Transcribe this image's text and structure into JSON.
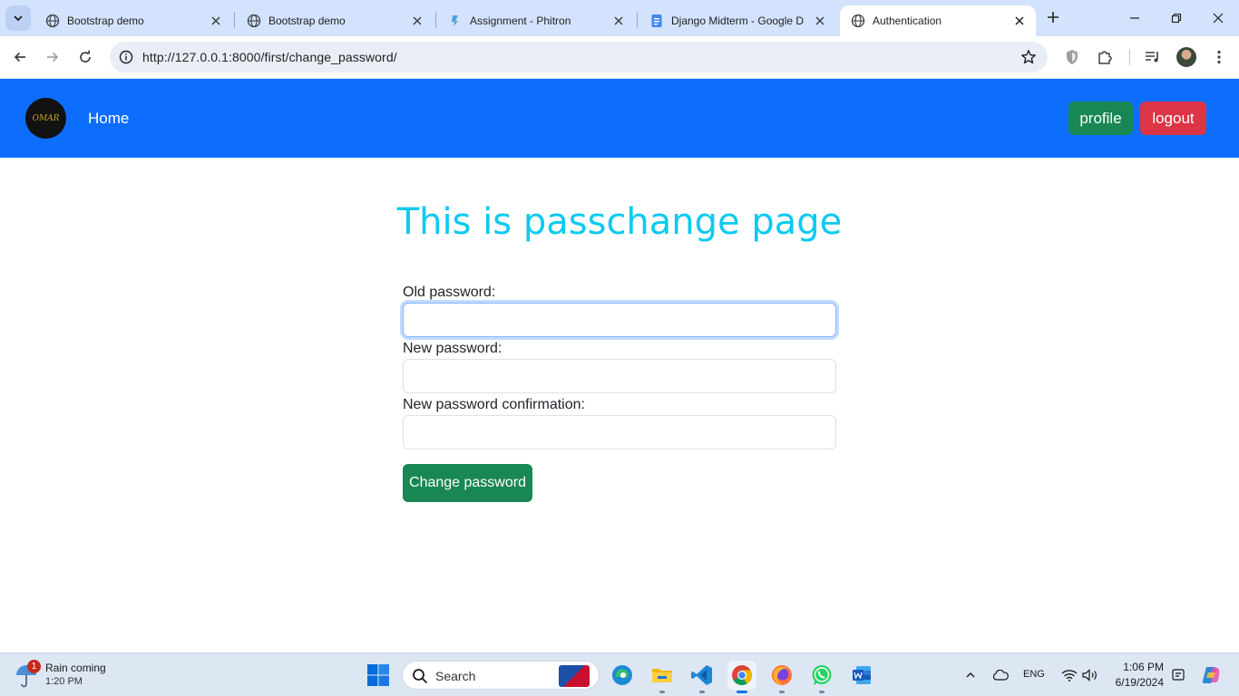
{
  "browser": {
    "tabs": [
      {
        "title": "Bootstrap demo",
        "icon": "globe-icon",
        "active": false
      },
      {
        "title": "Bootstrap demo",
        "icon": "globe-icon",
        "active": false
      },
      {
        "title": "Assignment - Phitron",
        "icon": "phitron-icon",
        "active": false
      },
      {
        "title": "Django Midterm - Google D",
        "icon": "google-docs-icon",
        "active": false
      },
      {
        "title": "Authentication",
        "icon": "globe-icon",
        "active": true
      }
    ],
    "url": "http://127.0.0.1:8000/first/change_password/"
  },
  "navbar": {
    "brand_text": "OMAR",
    "home_label": "Home",
    "profile_label": "profile",
    "logout_label": "logout",
    "colors": {
      "bar": "#0d6efd",
      "profile": "#198754",
      "logout": "#dc3545"
    }
  },
  "page": {
    "heading": "This is passchange page",
    "heading_color": "#0dcaf0",
    "form": {
      "old_password_label": "Old password:",
      "new_password_label": "New password:",
      "confirm_password_label": "New password confirmation:",
      "old_password_value": "",
      "new_password_value": "",
      "confirm_password_value": "",
      "submit_label": "Change password"
    }
  },
  "taskbar": {
    "weather_title": "Rain coming",
    "weather_time": "1:20 PM",
    "weather_badge": "1",
    "search_label": "Search",
    "language": "ENG",
    "clock_time": "1:06 PM",
    "clock_date": "6/19/2024",
    "apps": [
      "edge-icon",
      "file-explorer-icon",
      "vscode-icon",
      "chrome-icon",
      "firefox-icon",
      "whatsapp-icon",
      "word-icon"
    ]
  }
}
